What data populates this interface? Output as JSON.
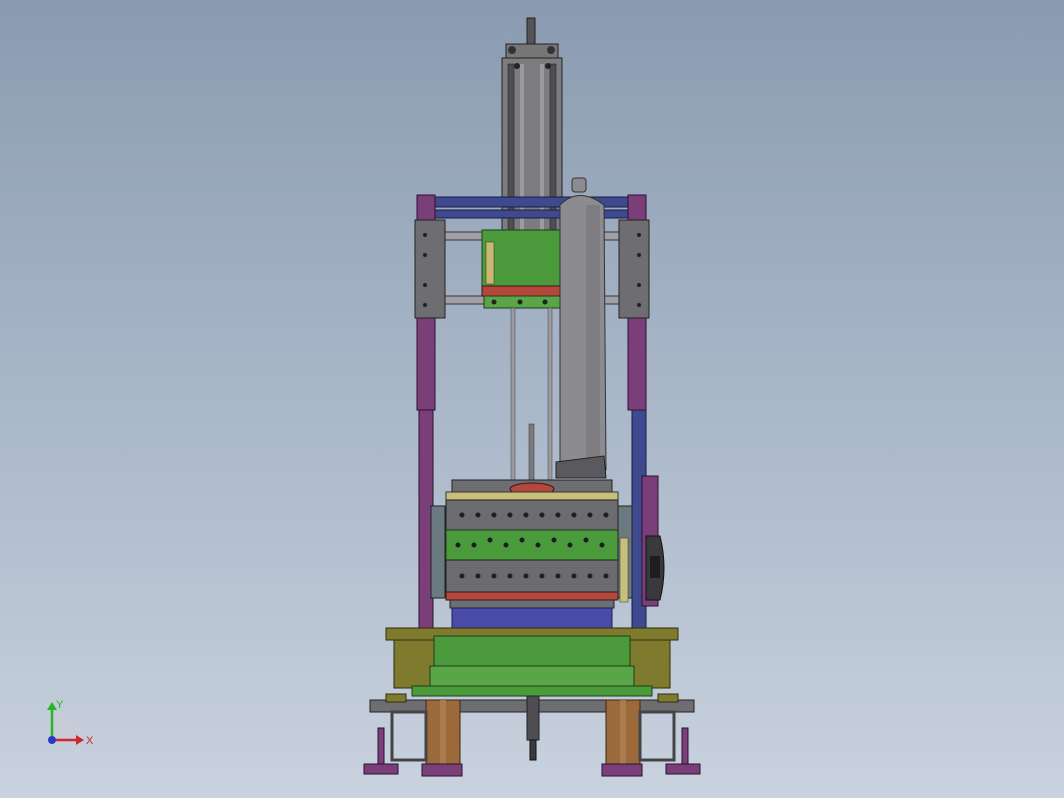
{
  "viewport": {
    "background_top": "#8a9bb1",
    "background_bottom": "#c9d2de"
  },
  "model": {
    "colors": {
      "frame_purple": "#7a3f78",
      "frame_blue": "#3e4a8f",
      "plate_gray": "#6e6e72",
      "cylinder_gray": "#808084",
      "tank_gray": "#8c8c90",
      "green": "#4b9a3c",
      "olive": "#7e7a2e",
      "drum_blue": "#4a4aa8",
      "red_accent": "#b4463c",
      "copper_leg": "#9c6a3a",
      "dark": "#2a2a2a"
    }
  },
  "triad": {
    "y_label": "Y",
    "x_label": "X",
    "y_color": "#28b428",
    "x_color": "#d02828",
    "z_color": "#2838c8"
  }
}
